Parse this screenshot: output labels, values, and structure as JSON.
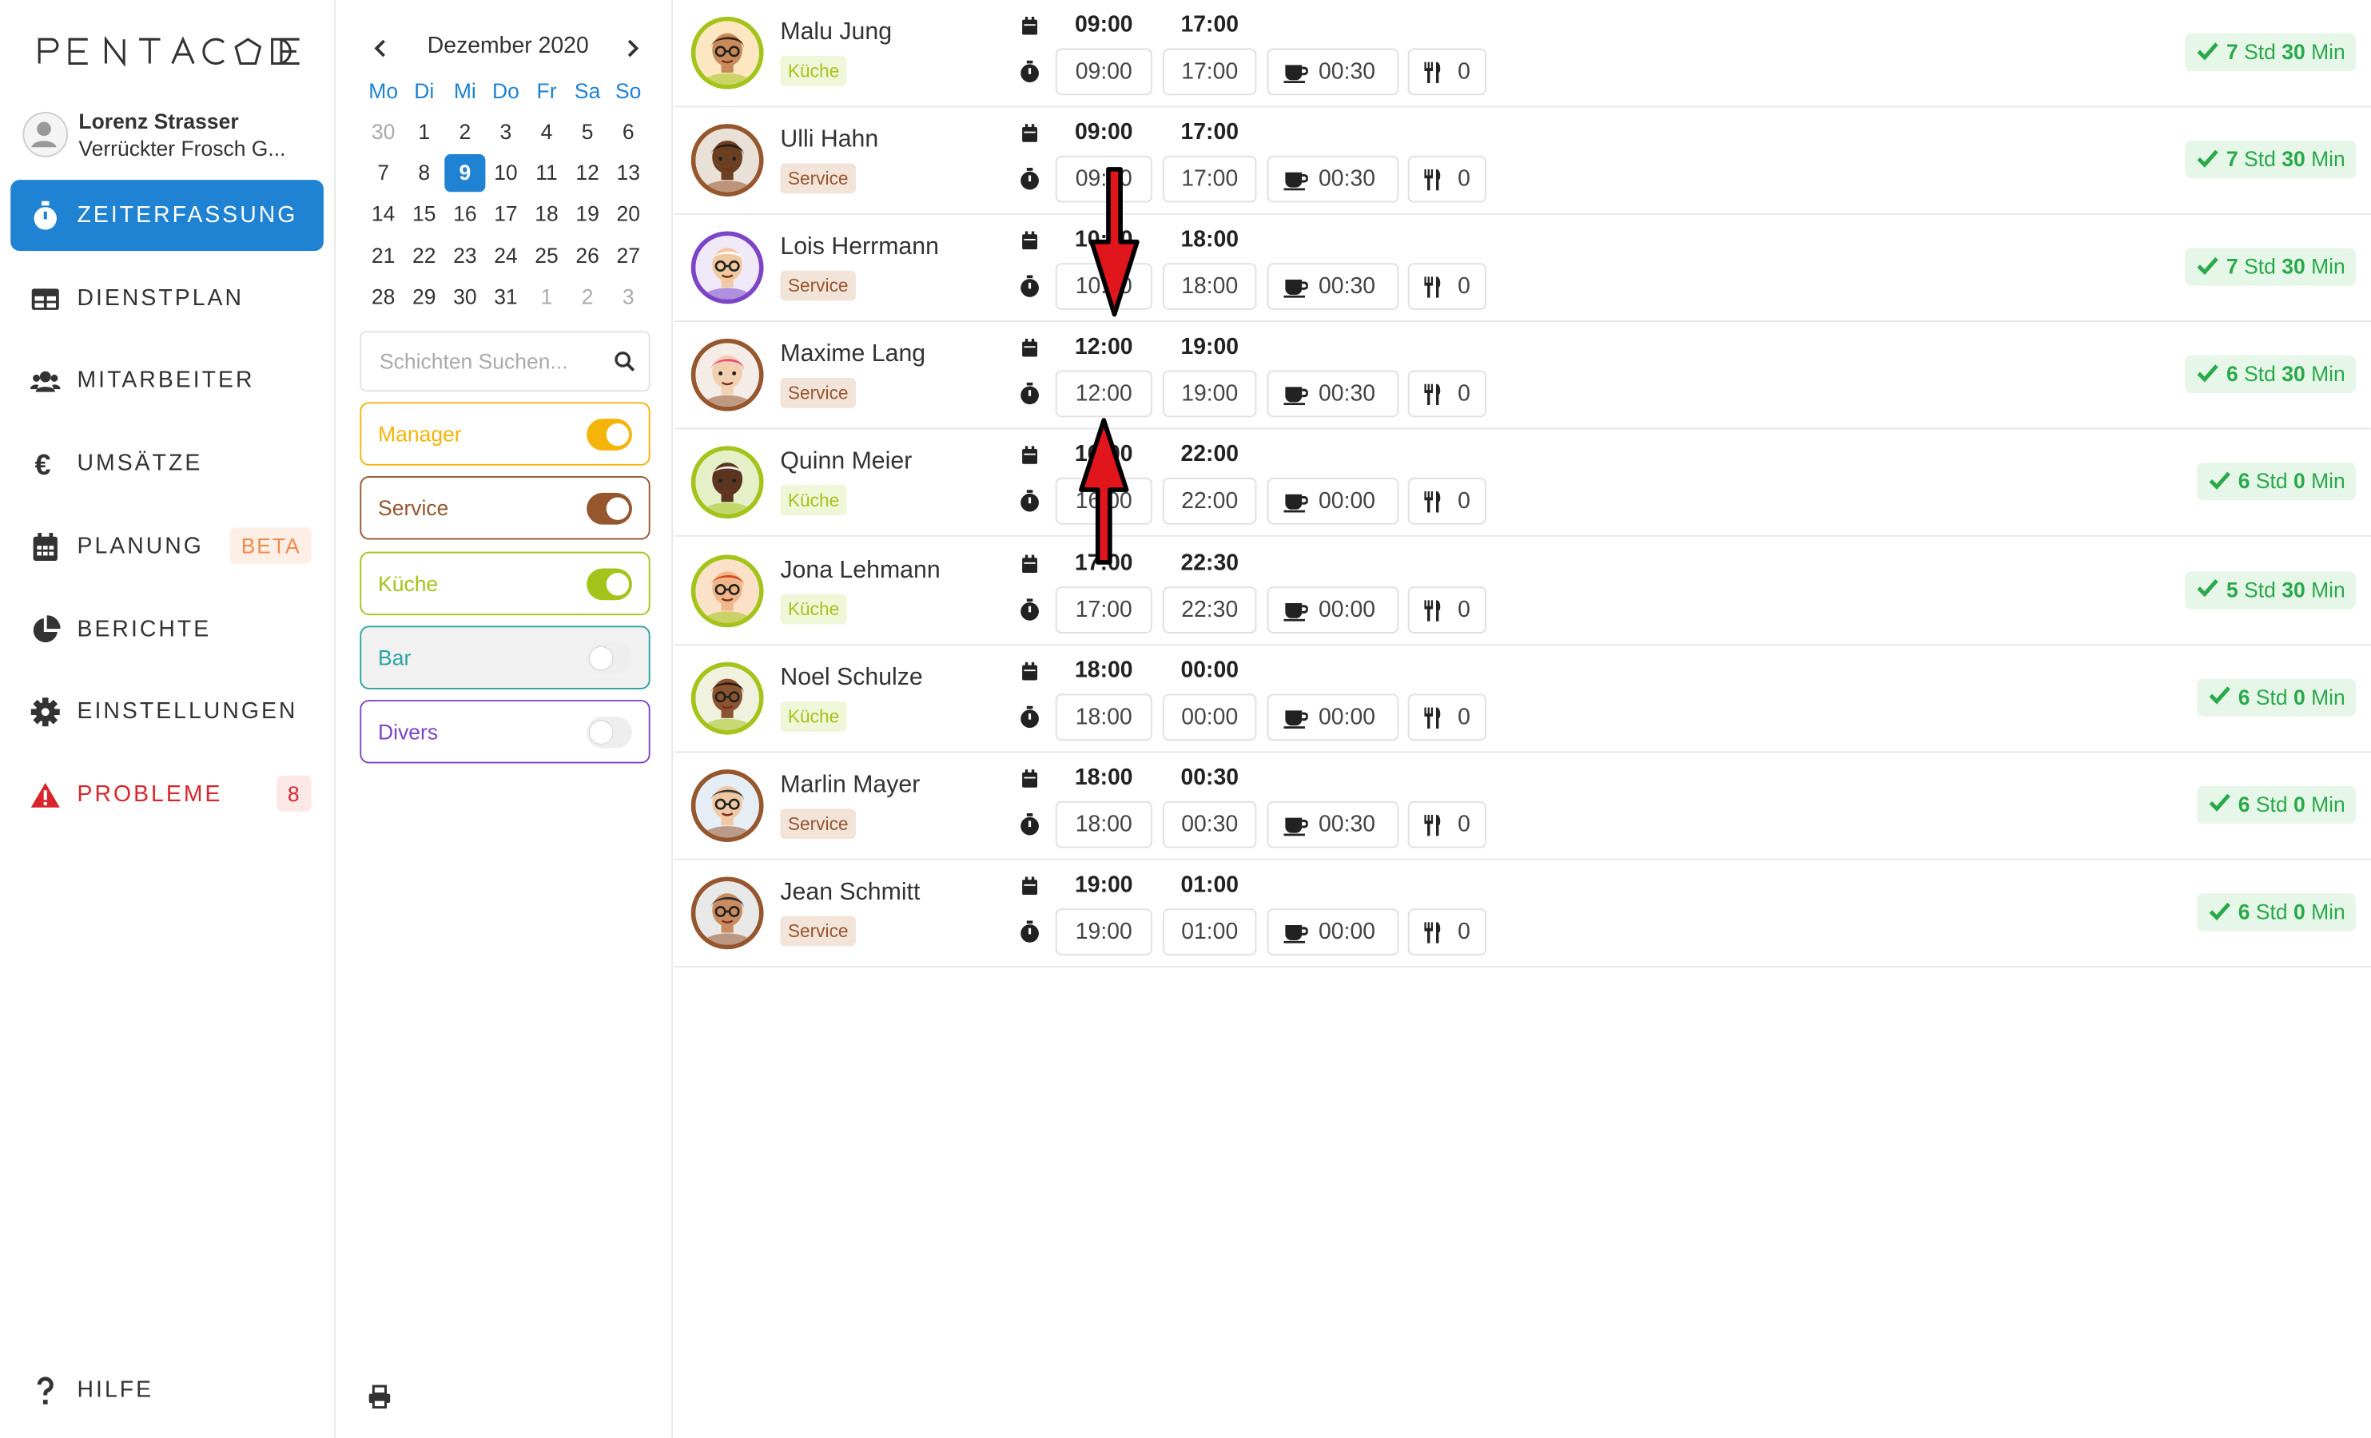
{
  "app": {
    "logo": "PENTACODE"
  },
  "user": {
    "name": "Lorenz Strasser",
    "org": "Verrückter Frosch G..."
  },
  "nav": [
    {
      "label": "ZEITERFASSUNG",
      "icon": "stopwatch-icon",
      "active": true
    },
    {
      "label": "DIENSTPLAN",
      "icon": "table-icon"
    },
    {
      "label": "MITARBEITER",
      "icon": "users-icon"
    },
    {
      "label": "UMSÄTZE",
      "icon": "euro-icon"
    },
    {
      "label": "PLANUNG",
      "icon": "calendar-icon",
      "badge": "BETA"
    },
    {
      "label": "BERICHTE",
      "icon": "pie-chart-icon"
    },
    {
      "label": "EINSTELLUNGEN",
      "icon": "gear-icon"
    },
    {
      "label": "PROBLEME",
      "icon": "warning-icon",
      "badge": "8"
    }
  ],
  "help": {
    "label": "HILFE",
    "icon": "question-icon"
  },
  "calendar": {
    "month": "Dezember 2020",
    "weekdays": [
      "Mo",
      "Di",
      "Mi",
      "Do",
      "Fr",
      "Sa",
      "So"
    ],
    "weeks": [
      [
        "30",
        "1",
        "2",
        "3",
        "4",
        "5",
        "6"
      ],
      [
        "7",
        "8",
        "9",
        "10",
        "11",
        "12",
        "13"
      ],
      [
        "14",
        "15",
        "16",
        "17",
        "18",
        "19",
        "20"
      ],
      [
        "21",
        "22",
        "23",
        "24",
        "25",
        "26",
        "27"
      ],
      [
        "28",
        "29",
        "30",
        "31",
        "1",
        "2",
        "3"
      ]
    ],
    "selected": "9"
  },
  "search": {
    "placeholder": "Schichten Suchen..."
  },
  "filters": [
    {
      "label": "Manager",
      "on": true,
      "color": "#f5b40a"
    },
    {
      "label": "Service",
      "on": true,
      "color": "#96562e"
    },
    {
      "label": "Küche",
      "on": true,
      "color": "#a4c41c"
    },
    {
      "label": "Bar",
      "on": false,
      "color": "#2aa3a6"
    },
    {
      "label": "Divers",
      "on": false,
      "color": "#7b45c6"
    }
  ],
  "employees": [
    {
      "name": "Malu Jung",
      "role": "Küche",
      "plan_start": "09:00",
      "plan_end": "17:00",
      "start": "09:00",
      "end": "17:00",
      "break": "00:30",
      "meals": "0",
      "total_h": "7",
      "total_m": "30"
    },
    {
      "name": "Ulli Hahn",
      "role": "Service",
      "plan_start": "09:00",
      "plan_end": "17:00",
      "start": "09:00",
      "end": "17:00",
      "break": "00:30",
      "meals": "0",
      "total_h": "7",
      "total_m": "30"
    },
    {
      "name": "Lois Herrmann",
      "role": "Service",
      "plan_start": "10:30",
      "plan_end": "18:00",
      "start": "10:30",
      "end": "18:00",
      "break": "00:30",
      "meals": "0",
      "total_h": "7",
      "total_m": "30"
    },
    {
      "name": "Maxime Lang",
      "role": "Service",
      "plan_start": "12:00",
      "plan_end": "19:00",
      "start": "12:00",
      "end": "19:00",
      "break": "00:30",
      "meals": "0",
      "total_h": "6",
      "total_m": "30"
    },
    {
      "name": "Quinn Meier",
      "role": "Küche",
      "plan_start": "16:00",
      "plan_end": "22:00",
      "start": "16:00",
      "end": "22:00",
      "break": "00:00",
      "meals": "0",
      "total_h": "6",
      "total_m": "0"
    },
    {
      "name": "Jona Lehmann",
      "role": "Küche",
      "plan_start": "17:00",
      "plan_end": "22:30",
      "start": "17:00",
      "end": "22:30",
      "break": "00:00",
      "meals": "0",
      "total_h": "5",
      "total_m": "30"
    },
    {
      "name": "Noel Schulze",
      "role": "Küche",
      "plan_start": "18:00",
      "plan_end": "00:00",
      "start": "18:00",
      "end": "00:00",
      "break": "00:00",
      "meals": "0",
      "total_h": "6",
      "total_m": "0"
    },
    {
      "name": "Marlin Mayer",
      "role": "Service",
      "plan_start": "18:00",
      "plan_end": "00:30",
      "start": "18:00",
      "end": "00:30",
      "break": "00:30",
      "meals": "0",
      "total_h": "6",
      "total_m": "0"
    },
    {
      "name": "Jean Schmitt",
      "role": "Service",
      "plan_start": "19:00",
      "plan_end": "01:00",
      "start": "19:00",
      "end": "01:00",
      "break": "00:00",
      "meals": "0",
      "total_h": "6",
      "total_m": "0"
    }
  ],
  "labels": {
    "std": "Std",
    "min": "Min"
  },
  "colors": {
    "accent": "#1f82d2",
    "danger": "#d9262c",
    "success": "#2aa94a",
    "beta_bg": "#fdeee6",
    "beta_fg": "#f08a4b",
    "kueche_bg": "#f0f6d8",
    "kueche_fg": "#a4c41c",
    "service_bg": "#f3e4da",
    "service_fg": "#96562e",
    "arrow": "#e0161c"
  }
}
